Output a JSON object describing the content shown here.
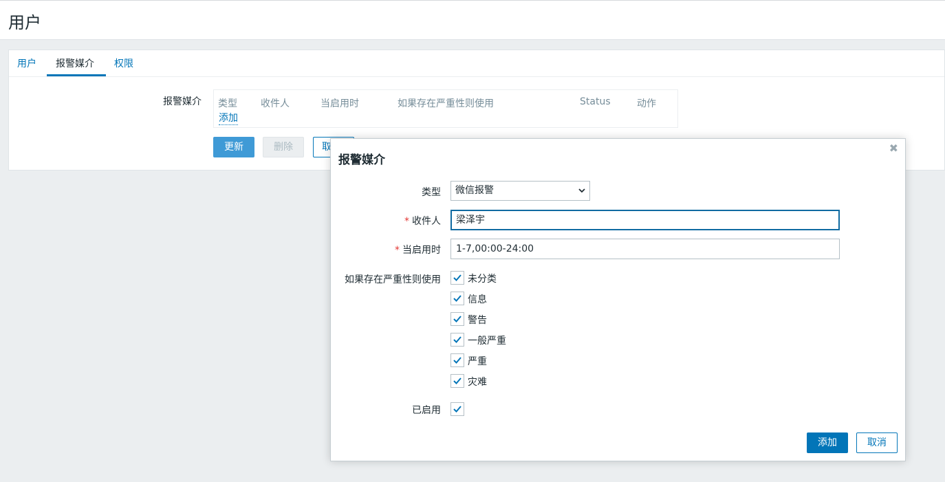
{
  "page": {
    "title": "用户"
  },
  "tabs": [
    {
      "label": "用户"
    },
    {
      "label": "报警媒介"
    },
    {
      "label": "权限"
    }
  ],
  "media_form": {
    "label": "报警媒介",
    "columns": [
      "类型",
      "收件人",
      "当启用时",
      "如果存在严重性则使用",
      "Status",
      "动作"
    ],
    "add_link": "添加",
    "buttons": {
      "update": "更新",
      "delete": "删除",
      "cancel": "取"
    }
  },
  "dialog": {
    "title": "报警媒介",
    "close_icon": "close-icon",
    "type": {
      "label": "类型",
      "value": "微信报警"
    },
    "sendto": {
      "label": "收件人",
      "value": "梁泽宇"
    },
    "period": {
      "label": "当启用时",
      "value": "1-7,00:00-24:00"
    },
    "severity": {
      "label": "如果存在严重性则使用",
      "options": [
        {
          "label": "未分类",
          "checked": true
        },
        {
          "label": "信息",
          "checked": true
        },
        {
          "label": "警告",
          "checked": true
        },
        {
          "label": "一般严重",
          "checked": true
        },
        {
          "label": "严重",
          "checked": true
        },
        {
          "label": "灾难",
          "checked": true
        }
      ]
    },
    "enabled": {
      "label": "已启用",
      "checked": true
    },
    "buttons": {
      "add": "添加",
      "cancel": "取消"
    }
  },
  "colors": {
    "accent": "#0275b8",
    "required": "#e33734",
    "check": "#0275b8"
  }
}
